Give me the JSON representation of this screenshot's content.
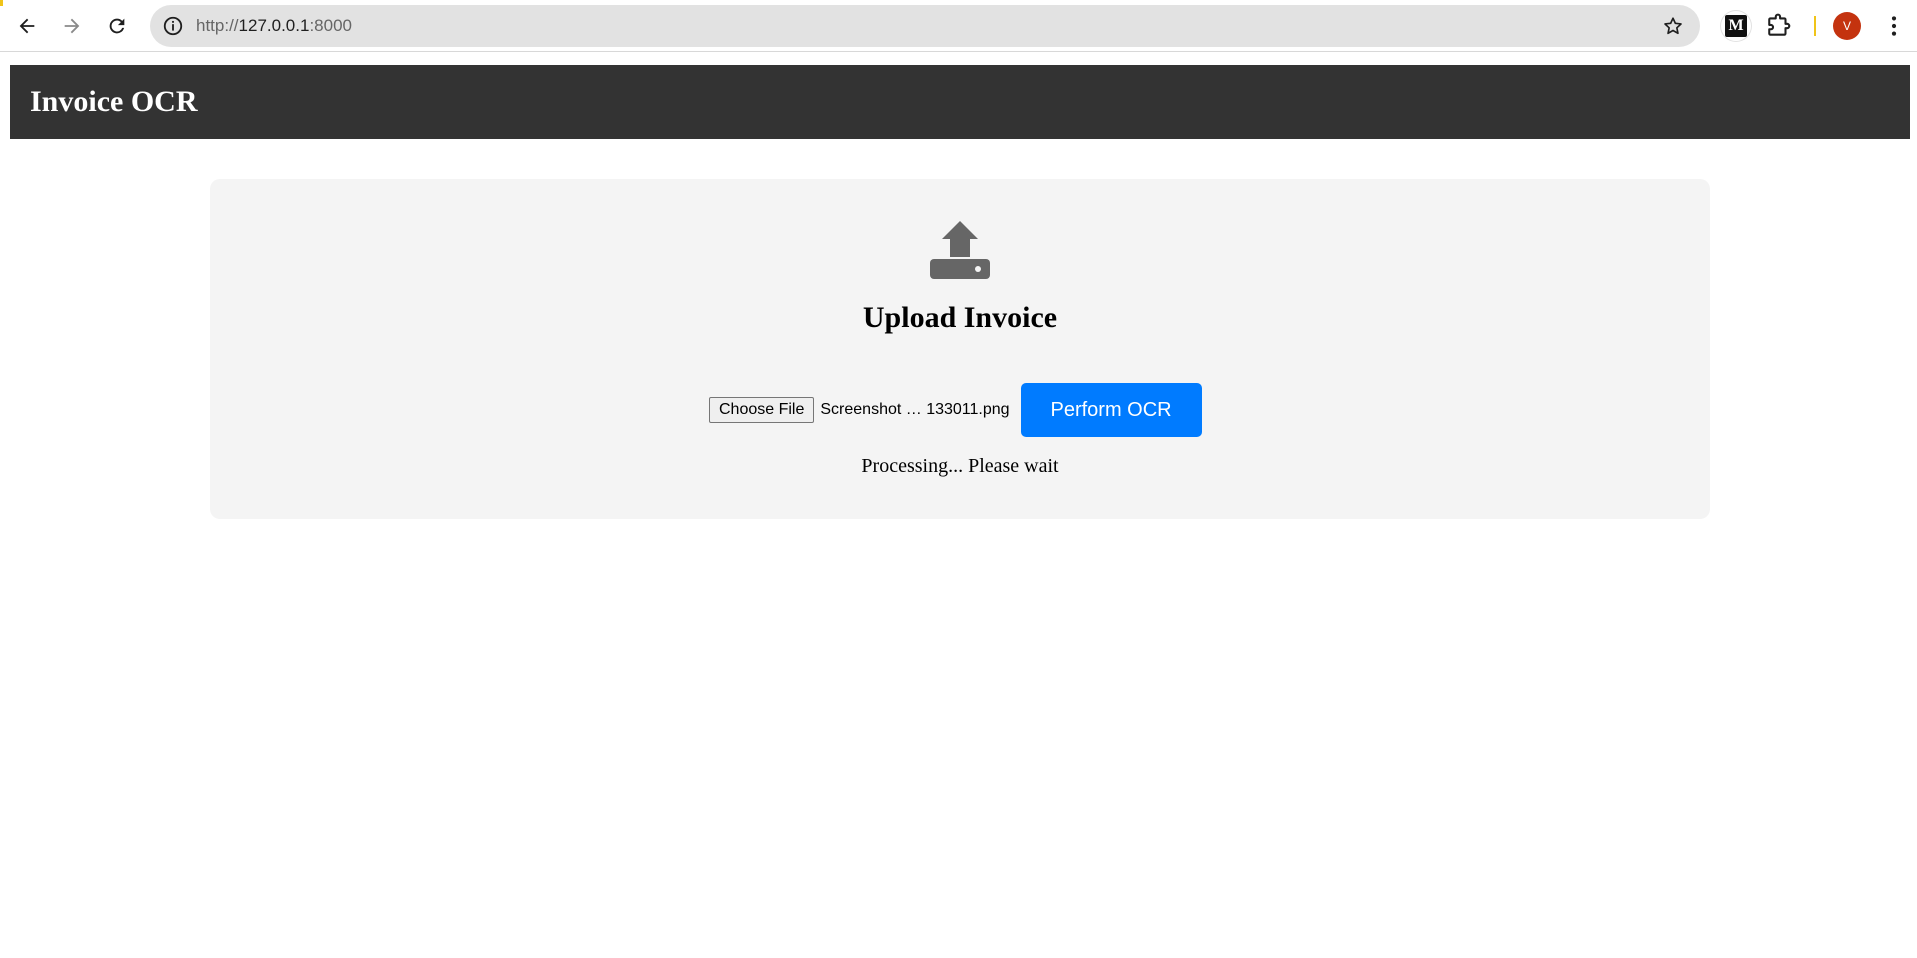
{
  "browser": {
    "url_scheme": "http://",
    "url_host": "127.0.0.1",
    "url_port": ":8000",
    "medium_ext_letter": "M",
    "avatar_letter": "V",
    "colors": {
      "avatar": "#c4330f",
      "address_bar": "#e2e2e2"
    },
    "icons": [
      "back-arrow-icon",
      "forward-arrow-icon",
      "reload-icon",
      "site-info-icon",
      "bookmark-star-icon",
      "medium-extension-icon",
      "extensions-puzzle-icon",
      "profile-avatar",
      "more-menu-icon"
    ]
  },
  "header": {
    "title": "Invoice OCR",
    "background": "#333333"
  },
  "upload": {
    "icon": "upload-tray-icon",
    "heading": "Upload Invoice",
    "choose_file_label": "Choose File",
    "file_name": "Screenshot … 133011.png",
    "submit_label": "Perform OCR",
    "submit_color": "#007bff",
    "status": "Processing... Please wait"
  }
}
